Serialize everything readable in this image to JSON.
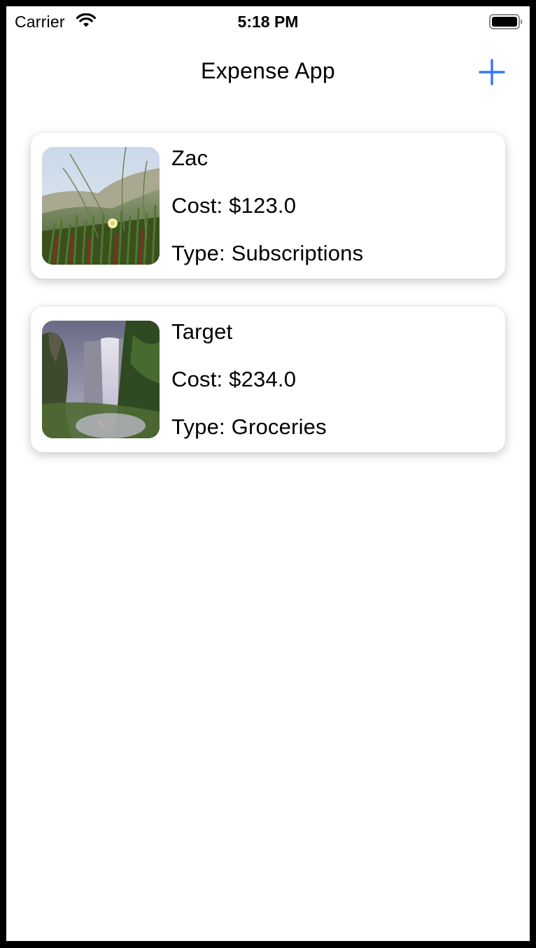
{
  "status_bar": {
    "carrier": "Carrier",
    "time": "5:18 PM",
    "icons": [
      "wifi-icon",
      "battery-icon"
    ]
  },
  "nav": {
    "title": "Expense App",
    "add_icon": "plus-icon",
    "accent_color": "#3478f6"
  },
  "expenses": [
    {
      "name": "Zac",
      "cost_label": "Cost: $123.0",
      "type_label": "Type: Subscriptions",
      "image": "grass-flower-photo"
    },
    {
      "name": "Target",
      "cost_label": "Cost: $234.0",
      "type_label": "Type: Groceries",
      "image": "waterfall-photo"
    }
  ]
}
